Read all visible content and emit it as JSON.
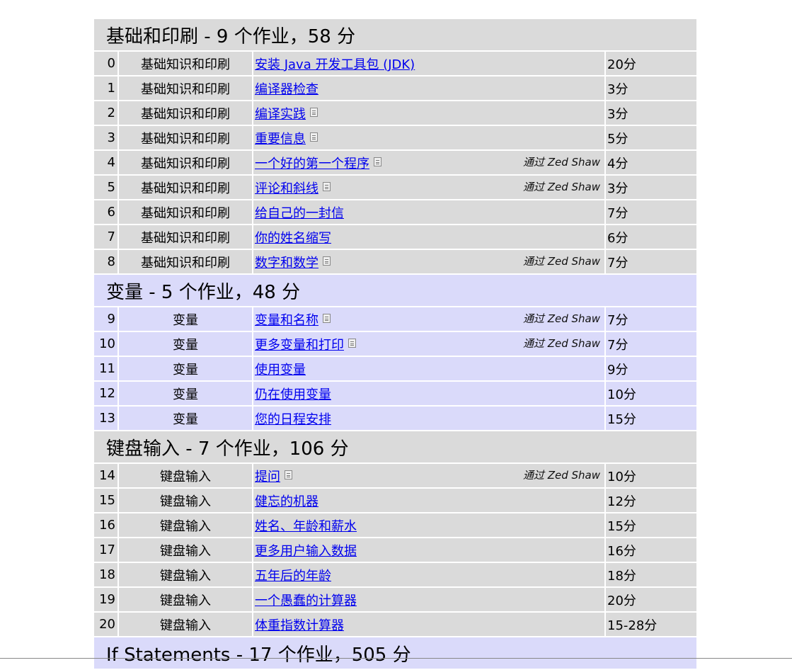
{
  "sections": [
    {
      "heading": "基础和印刷 - 9 个作业，58 分",
      "style": "gray",
      "rows": [
        {
          "num": "0",
          "category": "基础知识和印刷",
          "title": "安装 Java 开发工具包 (JDK)",
          "doc": false,
          "author": "",
          "points": "20分"
        },
        {
          "num": "1",
          "category": "基础知识和印刷",
          "title": "编译器检查",
          "doc": false,
          "author": "",
          "points": "3分"
        },
        {
          "num": "2",
          "category": "基础知识和印刷",
          "title": "编译实践",
          "doc": true,
          "author": "",
          "points": "3分"
        },
        {
          "num": "3",
          "category": "基础知识和印刷",
          "title": "重要信息",
          "doc": true,
          "author": "",
          "points": "5分"
        },
        {
          "num": "4",
          "category": "基础知识和印刷",
          "title": "一个好的第一个程序",
          "doc": true,
          "author": "通过 Zed Shaw",
          "points": "4分"
        },
        {
          "num": "5",
          "category": "基础知识和印刷",
          "title": "评论和斜线",
          "doc": true,
          "author": "通过 Zed Shaw",
          "points": "3分"
        },
        {
          "num": "6",
          "category": "基础知识和印刷",
          "title": "给自己的一封信",
          "doc": false,
          "author": "",
          "points": "7分"
        },
        {
          "num": "7",
          "category": "基础知识和印刷",
          "title": "你的姓名缩写",
          "doc": false,
          "author": "",
          "points": "6分"
        },
        {
          "num": "8",
          "category": "基础知识和印刷",
          "title": "数字和数学",
          "doc": true,
          "author": "通过 Zed Shaw",
          "points": "7分"
        }
      ]
    },
    {
      "heading": "变量 - 5 个作业，48 分",
      "style": "blue",
      "rows": [
        {
          "num": "9",
          "category": "变量",
          "title": "变量和名称",
          "doc": true,
          "author": "通过 Zed Shaw",
          "points": "7分"
        },
        {
          "num": "10",
          "category": "变量",
          "title": "更多变量和打印",
          "doc": true,
          "author": "通过 Zed Shaw",
          "points": "7分"
        },
        {
          "num": "11",
          "category": "变量",
          "title": "使用变量",
          "doc": false,
          "author": "",
          "points": "9分"
        },
        {
          "num": "12",
          "category": "变量",
          "title": "仍在使用变量",
          "doc": false,
          "author": "",
          "points": "10分"
        },
        {
          "num": "13",
          "category": "变量",
          "title": "您的日程安排",
          "doc": false,
          "author": "",
          "points": "15分"
        }
      ]
    },
    {
      "heading": "键盘输入 - 7 个作业，106 分",
      "style": "gray",
      "rows": [
        {
          "num": "14",
          "category": "键盘输入",
          "title": "提问",
          "doc": true,
          "author": "通过 Zed Shaw",
          "points": "10分"
        },
        {
          "num": "15",
          "category": "键盘输入",
          "title": "健忘的机器",
          "doc": false,
          "author": "",
          "points": "12分"
        },
        {
          "num": "16",
          "category": "键盘输入",
          "title": "姓名、年龄和薪水",
          "doc": false,
          "author": "",
          "points": "15分"
        },
        {
          "num": "17",
          "category": "键盘输入",
          "title": "更多用户输入数据",
          "doc": false,
          "author": "",
          "points": "16分"
        },
        {
          "num": "18",
          "category": "键盘输入",
          "title": "五年后的年龄",
          "doc": false,
          "author": "",
          "points": "18分"
        },
        {
          "num": "19",
          "category": "键盘输入",
          "title": "一个愚蠢的计算器",
          "doc": false,
          "author": "",
          "points": "20分"
        },
        {
          "num": "20",
          "category": "键盘输入",
          "title": "体重指数计算器",
          "doc": false,
          "author": "",
          "points": "15-28分"
        }
      ]
    },
    {
      "heading": "If Statements - 17 个作业，505 分",
      "style": "blue",
      "rows": []
    }
  ]
}
